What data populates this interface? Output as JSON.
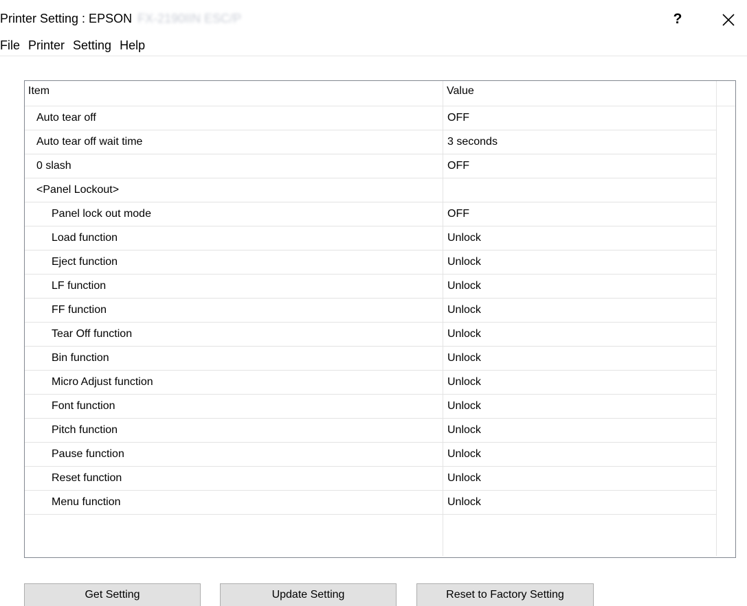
{
  "window": {
    "title_prefix": "Printer Setting : EPSON",
    "title_model_redacted": "FX-2190IIN ESC/P",
    "help_label": "?",
    "close_icon": "close-icon"
  },
  "menu": {
    "items": [
      "File",
      "Printer",
      "Setting",
      "Help"
    ]
  },
  "list": {
    "columns": {
      "item": "Item",
      "value": "Value"
    },
    "rows": [
      {
        "item": "Auto tear off",
        "value": "OFF",
        "level": 0
      },
      {
        "item": "Auto tear off wait time",
        "value": "3 seconds",
        "level": 0
      },
      {
        "item": "0 slash",
        "value": "OFF",
        "level": 0
      },
      {
        "item": "<Panel Lockout>",
        "value": "",
        "level": 0
      },
      {
        "item": "Panel lock out mode",
        "value": "OFF",
        "level": 1
      },
      {
        "item": "Load function",
        "value": "Unlock",
        "level": 1
      },
      {
        "item": "Eject function",
        "value": "Unlock",
        "level": 1
      },
      {
        "item": "LF function",
        "value": "Unlock",
        "level": 1
      },
      {
        "item": "FF function",
        "value": "Unlock",
        "level": 1
      },
      {
        "item": "Tear Off function",
        "value": "Unlock",
        "level": 1
      },
      {
        "item": "Bin function",
        "value": "Unlock",
        "level": 1
      },
      {
        "item": "Micro Adjust function",
        "value": "Unlock",
        "level": 1
      },
      {
        "item": "Font function",
        "value": "Unlock",
        "level": 1
      },
      {
        "item": "Pitch function",
        "value": "Unlock",
        "level": 1
      },
      {
        "item": "Pause function",
        "value": "Unlock",
        "level": 1
      },
      {
        "item": "Reset function",
        "value": "Unlock",
        "level": 1
      },
      {
        "item": "Menu function",
        "value": "Unlock",
        "level": 1
      }
    ]
  },
  "buttons": {
    "get": "Get Setting",
    "update": "Update Setting",
    "reset": "Reset to Factory Setting"
  }
}
